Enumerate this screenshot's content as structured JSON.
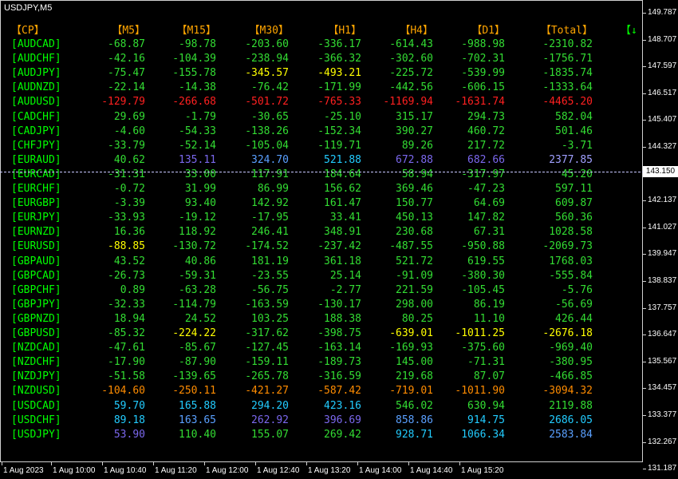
{
  "chart_title": "USDJPY,M5",
  "headers": [
    "【CP】",
    "【M5】",
    "【M15】",
    "【M30】",
    "【H1】",
    "【H4】",
    "【D1】",
    "【Total】"
  ],
  "arrow": "【↓",
  "colors": {
    "header": "#ffa500",
    "symbol": "#00ff00",
    "arrow": "#00ff00",
    "lime": "#00ff00",
    "green": "#33dd33",
    "yellow": "#ffff00",
    "gold": "#ffd700",
    "orange": "#ff8c00",
    "red": "#ff2020",
    "deepsky": "#22ccff",
    "steel": "#5aa0ff",
    "slate": "#7b68ee",
    "light_slate": "#a0a0ff"
  },
  "rows": [
    {
      "sym": "[AUDCAD]",
      "v": [
        "-68.87",
        "-98.78",
        "-203.60",
        "-336.17",
        "-614.43",
        "-988.98",
        "-2310.82"
      ],
      "c": [
        "green",
        "green",
        "green",
        "green",
        "green",
        "green",
        "green"
      ]
    },
    {
      "sym": "[AUDCHF]",
      "v": [
        "-42.16",
        "-104.39",
        "-238.94",
        "-366.32",
        "-302.60",
        "-702.31",
        "-1756.71"
      ],
      "c": [
        "green",
        "green",
        "green",
        "green",
        "green",
        "green",
        "green"
      ]
    },
    {
      "sym": "[AUDJPY]",
      "v": [
        "-75.47",
        "-155.78",
        "-345.57",
        "-493.21",
        "-225.72",
        "-539.99",
        "-1835.74"
      ],
      "c": [
        "green",
        "green",
        "yellow",
        "yellow",
        "green",
        "green",
        "green"
      ]
    },
    {
      "sym": "[AUDNZD]",
      "v": [
        "-22.14",
        "-14.38",
        "-76.42",
        "-171.99",
        "-442.56",
        "-606.15",
        "-1333.64"
      ],
      "c": [
        "green",
        "green",
        "green",
        "green",
        "green",
        "green",
        "green"
      ]
    },
    {
      "sym": "[AUDUSD]",
      "v": [
        "-129.79",
        "-266.68",
        "-501.72",
        "-765.33",
        "-1169.94",
        "-1631.74",
        "-4465.20"
      ],
      "c": [
        "red",
        "red",
        "red",
        "red",
        "red",
        "red",
        "red"
      ]
    },
    {
      "sym": "[CADCHF]",
      "v": [
        "29.69",
        "-1.79",
        "-30.65",
        "-25.10",
        "315.17",
        "294.73",
        "582.04"
      ],
      "c": [
        "green",
        "green",
        "green",
        "green",
        "green",
        "green",
        "green"
      ]
    },
    {
      "sym": "[CADJPY]",
      "v": [
        "-4.60",
        "-54.33",
        "-138.26",
        "-152.34",
        "390.27",
        "460.72",
        "501.46"
      ],
      "c": [
        "green",
        "green",
        "green",
        "green",
        "green",
        "green",
        "green"
      ]
    },
    {
      "sym": "[CHFJPY]",
      "v": [
        "-33.79",
        "-52.14",
        "-105.04",
        "-119.71",
        "89.26",
        "217.72",
        "-3.71"
      ],
      "c": [
        "green",
        "green",
        "green",
        "green",
        "green",
        "green",
        "green"
      ]
    },
    {
      "sym": "[EURAUD]",
      "v": [
        "40.62",
        "135.11",
        "324.70",
        "521.88",
        "672.88",
        "682.66",
        "2377.85"
      ],
      "c": [
        "green",
        "slate",
        "steel",
        "deepsky",
        "slate",
        "slate",
        "light_slate"
      ]
    },
    {
      "sym": "[EURCAD]",
      "v": [
        "-31.31",
        "33.00",
        "117.91",
        "184.64",
        "58.94",
        "-317.97",
        "45.20"
      ],
      "c": [
        "green",
        "green",
        "green",
        "green",
        "green",
        "green",
        "green"
      ]
    },
    {
      "sym": "[EURCHF]",
      "v": [
        "-0.72",
        "31.99",
        "86.99",
        "156.62",
        "369.46",
        "-47.23",
        "597.11"
      ],
      "c": [
        "green",
        "green",
        "green",
        "green",
        "green",
        "green",
        "green"
      ]
    },
    {
      "sym": "[EURGBP]",
      "v": [
        "-3.39",
        "93.40",
        "142.92",
        "161.47",
        "150.77",
        "64.69",
        "609.87"
      ],
      "c": [
        "green",
        "green",
        "green",
        "green",
        "green",
        "green",
        "green"
      ]
    },
    {
      "sym": "[EURJPY]",
      "v": [
        "-33.93",
        "-19.12",
        "-17.95",
        "33.41",
        "450.13",
        "147.82",
        "560.36"
      ],
      "c": [
        "green",
        "green",
        "green",
        "green",
        "green",
        "green",
        "green"
      ]
    },
    {
      "sym": "[EURNZD]",
      "v": [
        "16.36",
        "118.92",
        "246.41",
        "348.91",
        "230.68",
        "67.31",
        "1028.58"
      ],
      "c": [
        "green",
        "green",
        "green",
        "green",
        "green",
        "green",
        "green"
      ]
    },
    {
      "sym": "[EURUSD]",
      "v": [
        "-88.85",
        "-130.72",
        "-174.52",
        "-237.42",
        "-487.55",
        "-950.88",
        "-2069.73"
      ],
      "c": [
        "yellow",
        "green",
        "green",
        "green",
        "green",
        "green",
        "green"
      ]
    },
    {
      "sym": "[GBPAUD]",
      "v": [
        "43.52",
        "40.86",
        "181.19",
        "361.18",
        "521.72",
        "619.55",
        "1768.03"
      ],
      "c": [
        "green",
        "green",
        "green",
        "green",
        "green",
        "green",
        "green"
      ]
    },
    {
      "sym": "[GBPCAD]",
      "v": [
        "-26.73",
        "-59.31",
        "-23.55",
        "25.14",
        "-91.09",
        "-380.30",
        "-555.84"
      ],
      "c": [
        "green",
        "green",
        "green",
        "green",
        "green",
        "green",
        "green"
      ]
    },
    {
      "sym": "[GBPCHF]",
      "v": [
        "0.89",
        "-63.28",
        "-56.75",
        "-2.77",
        "221.59",
        "-105.45",
        "-5.76"
      ],
      "c": [
        "green",
        "green",
        "green",
        "green",
        "green",
        "green",
        "green"
      ]
    },
    {
      "sym": "[GBPJPY]",
      "v": [
        "-32.33",
        "-114.79",
        "-163.59",
        "-130.17",
        "298.00",
        "86.19",
        "-56.69"
      ],
      "c": [
        "green",
        "green",
        "green",
        "green",
        "green",
        "green",
        "green"
      ]
    },
    {
      "sym": "[GBPNZD]",
      "v": [
        "18.94",
        "24.52",
        "103.25",
        "188.38",
        "80.25",
        "11.10",
        "426.44"
      ],
      "c": [
        "green",
        "green",
        "green",
        "green",
        "green",
        "green",
        "green"
      ]
    },
    {
      "sym": "[GBPUSD]",
      "v": [
        "-85.32",
        "-224.22",
        "-317.62",
        "-398.75",
        "-639.01",
        "-1011.25",
        "-2676.18"
      ],
      "c": [
        "green",
        "yellow",
        "green",
        "green",
        "yellow",
        "yellow",
        "yellow"
      ]
    },
    {
      "sym": "[NZDCAD]",
      "v": [
        "-47.61",
        "-85.67",
        "-127.45",
        "-163.14",
        "-169.93",
        "-375.60",
        "-969.40"
      ],
      "c": [
        "green",
        "green",
        "green",
        "green",
        "green",
        "green",
        "green"
      ]
    },
    {
      "sym": "[NZDCHF]",
      "v": [
        "-17.90",
        "-87.90",
        "-159.11",
        "-189.73",
        "145.00",
        "-71.31",
        "-380.95"
      ],
      "c": [
        "green",
        "green",
        "green",
        "green",
        "green",
        "green",
        "green"
      ]
    },
    {
      "sym": "[NZDJPY]",
      "v": [
        "-51.58",
        "-139.65",
        "-265.78",
        "-316.59",
        "219.68",
        "87.07",
        "-466.85"
      ],
      "c": [
        "green",
        "green",
        "green",
        "green",
        "green",
        "green",
        "green"
      ]
    },
    {
      "sym": "[NZDUSD]",
      "v": [
        "-104.60",
        "-250.11",
        "-421.27",
        "-587.42",
        "-719.01",
        "-1011.90",
        "-3094.32"
      ],
      "c": [
        "orange",
        "orange",
        "orange",
        "orange",
        "orange",
        "orange",
        "orange"
      ]
    },
    {
      "sym": "[USDCAD]",
      "v": [
        "59.70",
        "165.88",
        "294.20",
        "423.16",
        "546.02",
        "630.94",
        "2119.88"
      ],
      "c": [
        "deepsky",
        "deepsky",
        "deepsky",
        "deepsky",
        "green",
        "green",
        "green"
      ]
    },
    {
      "sym": "[USDCHF]",
      "v": [
        "89.18",
        "163.65",
        "262.92",
        "396.69",
        "858.86",
        "914.75",
        "2686.05"
      ],
      "c": [
        "deepsky",
        "steel",
        "slate",
        "slate",
        "steel",
        "deepsky",
        "deepsky"
      ]
    },
    {
      "sym": "[USDJPY]",
      "v": [
        "53.90",
        "110.40",
        "155.07",
        "269.42",
        "928.71",
        "1066.34",
        "2583.84"
      ],
      "c": [
        "slate",
        "green",
        "green",
        "green",
        "deepsky",
        "deepsky",
        "steel"
      ]
    }
  ],
  "price_axis": [
    "149.787",
    "148.707",
    "147.597",
    "146.517",
    "145.407",
    "144.327",
    "143.150",
    "142.137",
    "141.027",
    "139.947",
    "138.837",
    "137.757",
    "136.647",
    "135.567",
    "134.457",
    "133.377",
    "132.267",
    "131.187"
  ],
  "current_price": "143.150",
  "time_axis": [
    "1 Aug 2023",
    "1 Aug 10:00",
    "1 Aug 10:40",
    "1 Aug 11:20",
    "1 Aug 12:00",
    "1 Aug 12:40",
    "1 Aug 13:20",
    "1 Aug 14:00",
    "1 Aug 14:40",
    "1 Aug 15:20"
  ]
}
